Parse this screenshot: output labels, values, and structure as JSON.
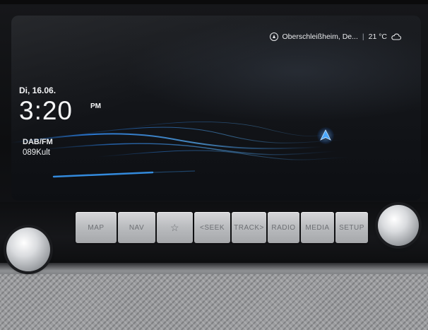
{
  "status": {
    "location": "Oberschleißheim, De...",
    "separator": "|",
    "temperature": "21 °C",
    "location_icon": "compass-icon",
    "weather_icon": "cloud-icon"
  },
  "clock": {
    "date": "Di, 16.06.",
    "time": "3:20",
    "ampm": "PM"
  },
  "media": {
    "source": "DAB/FM",
    "station": "089Kult"
  },
  "navigation": {
    "icon": "nav-arrow-icon"
  },
  "hardware_buttons": [
    "MAP",
    "NAV",
    "☆",
    "<SEEK",
    "TRACK>",
    "RADIO",
    "MEDIA",
    "SETUP"
  ],
  "colors": {
    "accent": "#3a9bff",
    "screen": "#121418"
  }
}
